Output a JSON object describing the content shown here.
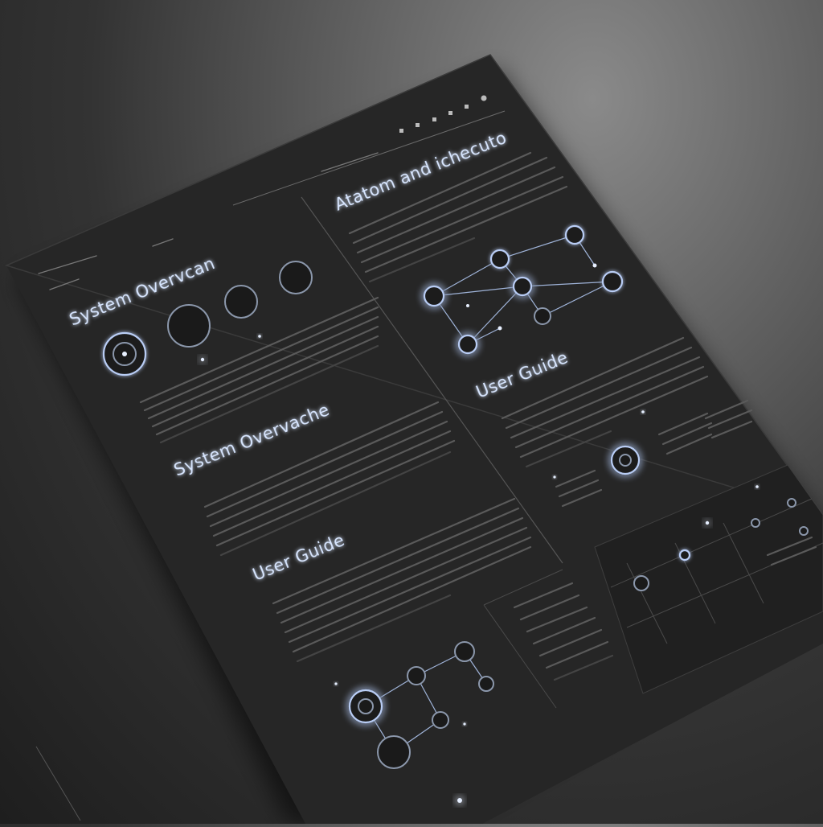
{
  "document": {
    "headings": {
      "top_right": "Atatom and ichecuto",
      "left_1": "System Overvcan",
      "left_2": "System Overvache",
      "left_3": "User Guide",
      "right_1": "User Guide"
    }
  },
  "icons": {
    "toolbar": [
      "square-icon",
      "square-icon",
      "square-icon",
      "square-icon",
      "square-icon",
      "circle-icon"
    ],
    "nodes": "node-circle-icon",
    "sparkle": "sparkle-icon"
  },
  "colors": {
    "background": "#4a4a4a",
    "document": "#262626",
    "accent_glow": "#b9cdf5",
    "heading_text": "#d8e6ff",
    "text_lines": "#5a5a5a"
  }
}
